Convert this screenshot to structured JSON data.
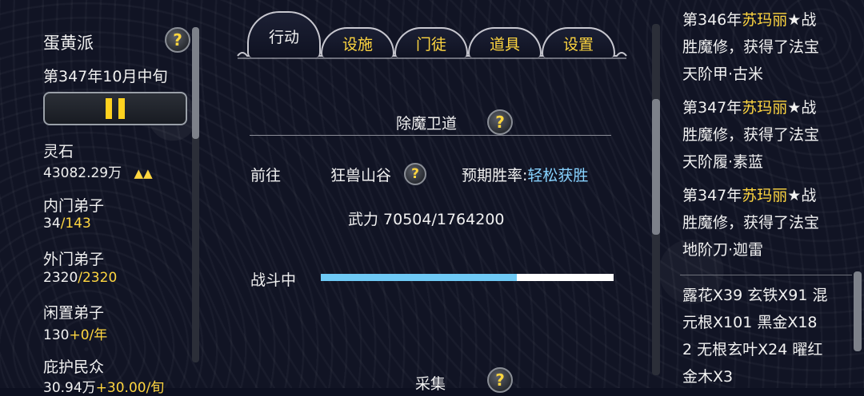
{
  "sidebar": {
    "sect_name": "蛋黄派",
    "date": "第347年10月中旬",
    "stats": [
      {
        "label": "灵石",
        "value": "43082.29万",
        "arrows": "▲▲"
      },
      {
        "label": "内门弟子",
        "value_a": "34",
        "value_b": "/143"
      },
      {
        "label": "外门弟子",
        "value_a": "2320",
        "value_b": "/2320"
      },
      {
        "label": "闲置弟子",
        "value_a": "130",
        "value_b": "+0/年"
      },
      {
        "label": "庇护民众",
        "value_a": "30.94万",
        "value_b": "+30.00/旬"
      }
    ]
  },
  "tabs": [
    {
      "label": "行动",
      "active": true
    },
    {
      "label": "设施"
    },
    {
      "label": "门徒"
    },
    {
      "label": "道具"
    },
    {
      "label": "设置"
    }
  ],
  "mission": {
    "title": "除魔卫道",
    "goto_label": "前往",
    "location": "狂兽山谷",
    "win_label": "预期胜率:",
    "win_value": "轻松获胜",
    "power": "武力 70504/1764200",
    "status": "战斗中",
    "progress": 0.67,
    "next_title": "采集"
  },
  "log": {
    "entries": [
      {
        "l1a": "第346年",
        "l1b": "苏玛丽",
        "l1c": "★战",
        "l2": "胜魔修，获得了法宝",
        "l3": "天阶甲·古米"
      },
      {
        "l1a": "第347年",
        "l1b": "苏玛丽",
        "l1c": "★战",
        "l2": "胜魔修，获得了法宝",
        "l3": "天阶履·素蓝"
      },
      {
        "l1a": "第347年",
        "l1b": "苏玛丽",
        "l1c": "★战",
        "l2": "胜魔修，获得了法宝",
        "l3": "地阶刀·迦雷"
      }
    ],
    "items": {
      "line1": "露花X39 玄铁X91 混",
      "line2": "元根X101 黑金X18",
      "line3": "2 无根玄叶X24 曜红",
      "line4": "金木X3"
    }
  },
  "colors": {
    "accent": "#ffd640",
    "blue": "#87d2ff",
    "progress": "#6ec9f5"
  }
}
